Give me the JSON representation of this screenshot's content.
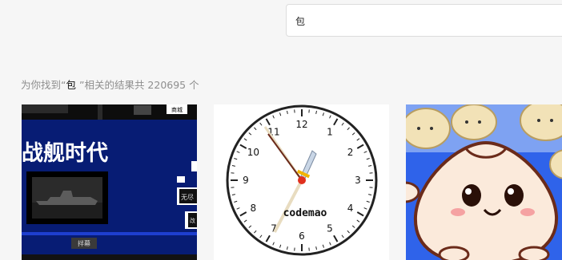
{
  "search": {
    "value": "包",
    "placeholder": ""
  },
  "results": {
    "prefix": "为你找到“",
    "keyword": "包",
    "suffix": " ”相关的结果共 220695 个"
  },
  "cards": [
    {
      "title_art": "战舰时代",
      "small_labels": [
        "拌幕",
        "无尽",
        "改"
      ],
      "corner_label": "商城",
      "colors": {
        "bg": "#071c74",
        "panel": "#101010"
      }
    },
    {
      "brand": "codemao",
      "clock_numbers": [
        "12",
        "1",
        "2",
        "3",
        "4",
        "5",
        "6",
        "7",
        "8",
        "9",
        "10",
        "11"
      ]
    },
    {
      "subject": "steamed-bun character illustration",
      "colors": {
        "sky": "#2f63ea",
        "bun": "#fbeadb"
      }
    }
  ]
}
